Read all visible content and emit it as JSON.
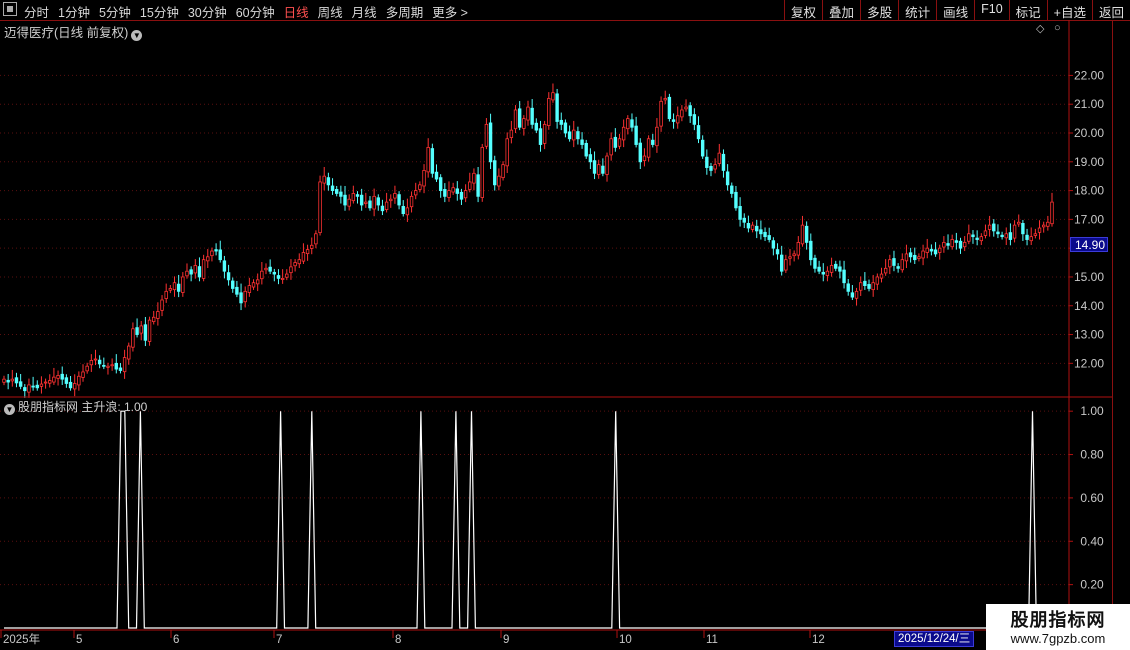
{
  "toolbar": {
    "periods": [
      "分时",
      "1分钟",
      "5分钟",
      "15分钟",
      "30分钟",
      "60分钟",
      "日线",
      "周线",
      "月线",
      "多周期",
      "更多 >"
    ],
    "active_period": "日线",
    "actions": [
      "复权",
      "叠加",
      "多股",
      "统计",
      "画线",
      "F10",
      "标记",
      "+自选",
      "返回"
    ]
  },
  "main_chart": {
    "title": "迈得医疗(日线 前复权)",
    "current_price_label": "14.90",
    "y_labels": [
      "22.00",
      "21.00",
      "20.00",
      "19.00",
      "18.00",
      "17.00",
      "16.00",
      "15.00",
      "14.00",
      "13.00",
      "12.00"
    ]
  },
  "sub_chart": {
    "title": "股朋指标网 主升浪: 1.00",
    "y_labels": [
      "1.00",
      "0.80",
      "0.60",
      "0.40",
      "0.20"
    ]
  },
  "x_axis": {
    "labels": [
      "2025年",
      "5",
      "6",
      "7",
      "8",
      "9",
      "10",
      "11",
      "12"
    ],
    "cursor_date": "2025/12/24/三"
  },
  "watermark": {
    "line1": "股朋指标网",
    "line2": "www.7gpzb.com"
  },
  "colors": {
    "up": "#ff3232",
    "down": "#54ffff",
    "axis": "#b01010",
    "grid": "#5a0f0f",
    "signal": "#ffffff"
  },
  "chart_data": [
    {
      "type": "candlestick",
      "title": "迈得医疗(日线 前复权)",
      "ylim": [
        10.9,
        23.3
      ],
      "close": [
        11.45,
        11.35,
        11.45,
        11.32,
        11.2,
        11.05,
        11.25,
        11.2,
        11.15,
        11.28,
        11.35,
        11.4,
        11.52,
        11.58,
        11.45,
        11.3,
        11.15,
        11.3,
        11.55,
        11.7,
        11.9,
        12.1,
        12.15,
        11.98,
        11.9,
        11.9,
        11.95,
        11.8,
        11.75,
        12.2,
        12.6,
        13.2,
        13.0,
        13.3,
        12.8,
        13.5,
        13.6,
        13.8,
        14.2,
        14.5,
        14.6,
        14.8,
        14.5,
        15.0,
        15.2,
        15.1,
        15.4,
        15.0,
        15.6,
        15.7,
        15.9,
        15.9,
        15.6,
        15.2,
        14.9,
        14.6,
        14.4,
        14.1,
        14.5,
        14.7,
        14.8,
        14.9,
        15.2,
        15.3,
        15.2,
        15.1,
        14.95,
        14.95,
        15.1,
        15.35,
        15.5,
        15.6,
        15.85,
        15.95,
        16.1,
        16.5,
        18.3,
        18.5,
        18.2,
        18.0,
        17.9,
        17.8,
        17.5,
        17.7,
        17.9,
        17.8,
        17.5,
        17.6,
        17.4,
        17.8,
        17.5,
        17.3,
        17.6,
        17.7,
        17.9,
        17.5,
        17.2,
        17.4,
        17.8,
        18.0,
        18.2,
        18.7,
        19.5,
        18.6,
        18.4,
        18.0,
        17.8,
        18.0,
        18.1,
        17.9,
        17.7,
        18.0,
        18.3,
        18.6,
        17.8,
        19.5,
        20.3,
        19.0,
        18.2,
        18.5,
        18.9,
        19.8,
        20.1,
        20.8,
        20.2,
        20.5,
        20.9,
        20.3,
        20.1,
        19.6,
        20.3,
        21.2,
        21.4,
        20.4,
        20.3,
        20.0,
        19.8,
        20.1,
        19.8,
        19.6,
        19.2,
        19.0,
        18.6,
        18.9,
        18.6,
        19.2,
        19.8,
        19.5,
        19.8,
        20.2,
        20.5,
        20.2,
        19.6,
        19.0,
        19.2,
        19.8,
        19.6,
        20.2,
        21.1,
        21.2,
        20.5,
        20.4,
        20.6,
        20.8,
        20.9,
        20.6,
        20.3,
        19.8,
        19.2,
        18.8,
        18.7,
        18.9,
        19.3,
        18.7,
        18.2,
        17.9,
        17.4,
        17.0,
        16.9,
        16.7,
        16.8,
        16.6,
        16.5,
        16.4,
        16.3,
        16.0,
        15.8,
        15.2,
        15.6,
        15.7,
        15.8,
        16.2,
        16.8,
        16.2,
        15.6,
        15.3,
        15.2,
        15.1,
        15.2,
        15.4,
        15.3,
        15.2,
        14.8,
        14.5,
        14.3,
        14.5,
        14.8,
        14.7,
        14.6,
        14.8,
        15.0,
        15.1,
        15.3,
        15.6,
        15.4,
        15.3,
        15.6,
        15.8,
        15.7,
        15.6,
        15.7,
        15.9,
        16.0,
        15.9,
        15.8,
        16.0,
        16.2,
        16.1,
        16.3,
        16.2,
        16.0,
        16.2,
        16.5,
        16.4,
        16.3,
        16.4,
        16.6,
        16.8,
        16.6,
        16.5,
        16.4,
        16.5,
        16.3,
        16.8,
        16.9,
        16.5,
        16.3,
        16.4,
        16.5,
        16.7,
        16.8,
        16.9,
        17.6
      ]
    },
    {
      "type": "line",
      "title": "主升浪",
      "ylim": [
        0,
        1.07
      ],
      "bar_count": 270,
      "value": "1.00",
      "signal_on_bar_indices": [
        [
          30,
          31
        ],
        [
          35
        ],
        [
          71
        ],
        [
          79
        ],
        [
          107
        ],
        [
          116
        ],
        [
          120
        ],
        [
          157
        ],
        [
          264
        ]
      ]
    }
  ]
}
